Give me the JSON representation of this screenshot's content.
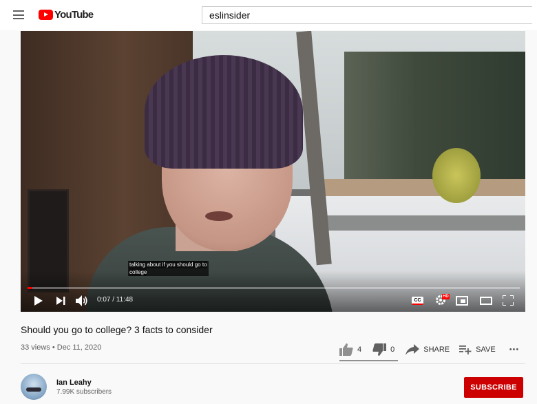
{
  "header": {
    "logo_text": "YouTube",
    "search_value": "eslinsider"
  },
  "player": {
    "caption_line1": "talking about if you should go to",
    "caption_line2": "college",
    "time": "0:07 / 11:48",
    "progress_fraction": 0.0099,
    "cc_label": "CC",
    "hd_label": "HD"
  },
  "video": {
    "title": "Should you go to college? 3 facts to consider",
    "views": "33 views",
    "date_sep": " • ",
    "date": "Dec 11, 2020",
    "likes": "4",
    "dislikes": "0",
    "share_label": "SHARE",
    "save_label": "SAVE",
    "more_label": "•••"
  },
  "channel": {
    "name": "Ian Leahy",
    "subscribers": "7.99K subscribers",
    "subscribe_label": "SUBSCRIBE"
  },
  "colors": {
    "brand_red": "#ff0000",
    "subscribe_red": "#cc0000"
  }
}
